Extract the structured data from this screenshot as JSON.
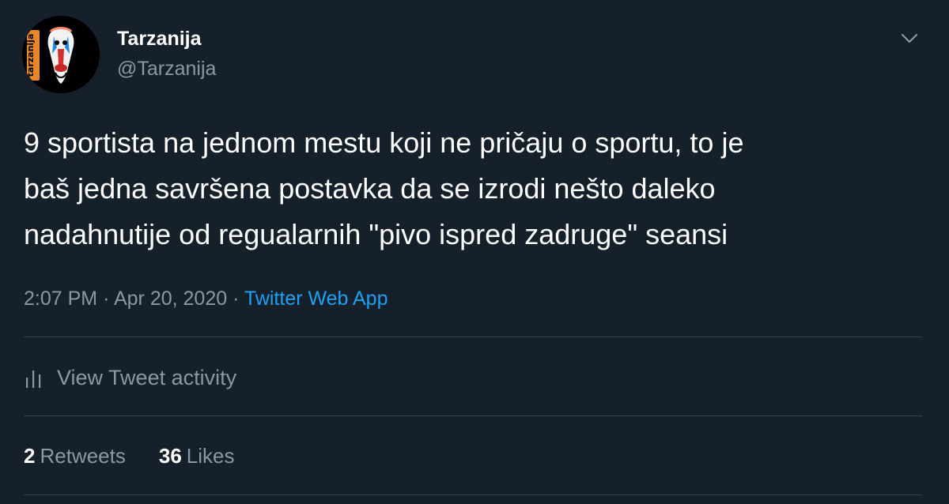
{
  "author": {
    "display_name": "Tarzanija",
    "handle": "@Tarzanija",
    "avatar_icon": "mandrill-avatar-icon",
    "avatar_logo_text": "tarzanija"
  },
  "tweet": {
    "text": "9 sportista na jednom mestu koji ne pričaju o sportu, to je\nbaš jedna savršena postavka da se izrodi nešto daleko\nnadahnutije od regualarnih \"pivo ispred zadruge\" seansi",
    "time": "2:07 PM",
    "separator": "·",
    "date": "Apr 20, 2020",
    "source": "Twitter Web App"
  },
  "activity": {
    "icon": "bar-chart-icon",
    "label": "View Tweet activity"
  },
  "stats": {
    "retweets_count": "2",
    "retweets_label": "Retweets",
    "likes_count": "36",
    "likes_label": "Likes"
  },
  "colors": {
    "background": "#15202b",
    "primary_text": "#ffffff",
    "secondary_text": "#8899a6",
    "link": "#1da1f2",
    "divider": "#38444d"
  }
}
